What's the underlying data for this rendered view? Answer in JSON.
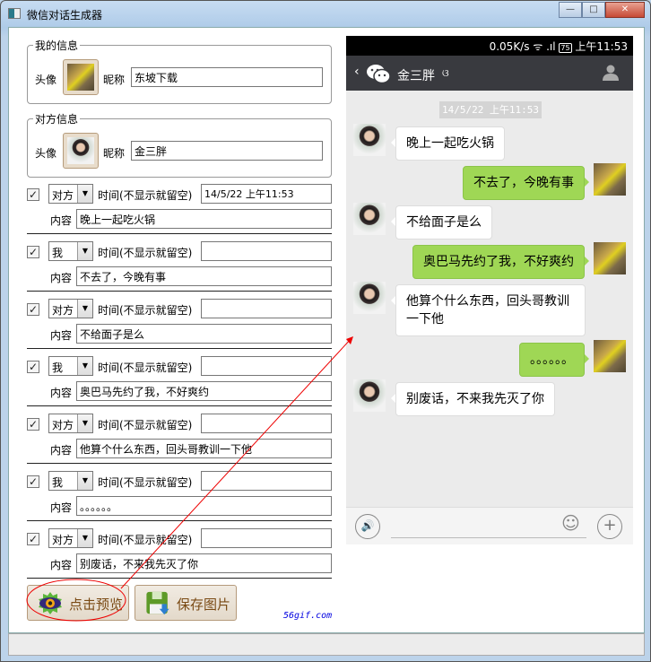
{
  "window": {
    "title": "微信对话生成器",
    "minimize": "—",
    "maximize": "□",
    "close": "✕"
  },
  "my_info": {
    "group_title": "我的信息",
    "avatar_label": "头像",
    "nickname_label": "昵称",
    "nickname": "东坡下载"
  },
  "other_info": {
    "group_title": "对方信息",
    "avatar_label": "头像",
    "nickname_label": "昵称",
    "nickname": "金三胖"
  },
  "labels": {
    "time": "时间(不显示就留空)",
    "content": "内容",
    "checked": "✓"
  },
  "messages": [
    {
      "sender": "对方",
      "time": "14/5/22 上午11:53",
      "content": "晚上一起吃火锅",
      "checked": true
    },
    {
      "sender": "我",
      "time": "",
      "content": "不去了，今晚有事",
      "checked": true
    },
    {
      "sender": "对方",
      "time": "",
      "content": "不给面子是么",
      "checked": true
    },
    {
      "sender": "我",
      "time": "",
      "content": "奥巴马先约了我，不好爽约",
      "checked": true
    },
    {
      "sender": "对方",
      "time": "",
      "content": "他算个什么东西，回头哥教训一下他",
      "checked": true
    },
    {
      "sender": "我",
      "time": "",
      "content": "。。。。。。",
      "checked": true
    },
    {
      "sender": "对方",
      "time": "",
      "content": "别废话，不来我先灭了你",
      "checked": true
    }
  ],
  "buttons": {
    "preview": "点击预览",
    "save": "保存图片"
  },
  "watermark": "56gif.com",
  "phone": {
    "status": {
      "speed": "0.05K/s",
      "battery": "75",
      "time": "上午11:53"
    },
    "header": {
      "back": "‹",
      "contact": "金三胖",
      "ear": "ଓ"
    },
    "timestamp": "14/5/22 上午11:53",
    "chat": [
      {
        "side": "l",
        "text": "晚上一起吃火锅"
      },
      {
        "side": "r",
        "text": "不去了，今晚有事"
      },
      {
        "side": "l",
        "text": "不给面子是么"
      },
      {
        "side": "r",
        "text": "奥巴马先约了我，不好爽约"
      },
      {
        "side": "l",
        "text": "他算个什么东西，回头哥教训一下他"
      },
      {
        "side": "r",
        "text": "。。。。。。"
      },
      {
        "side": "l",
        "text": "别废话，不来我先灭了你"
      }
    ],
    "bottom": {
      "voice": "🔊",
      "emoji": "☺",
      "plus": "+"
    }
  },
  "colors": {
    "wechat_green": "#9fd755",
    "header": "#393a3f",
    "annotation": "#e00000"
  }
}
